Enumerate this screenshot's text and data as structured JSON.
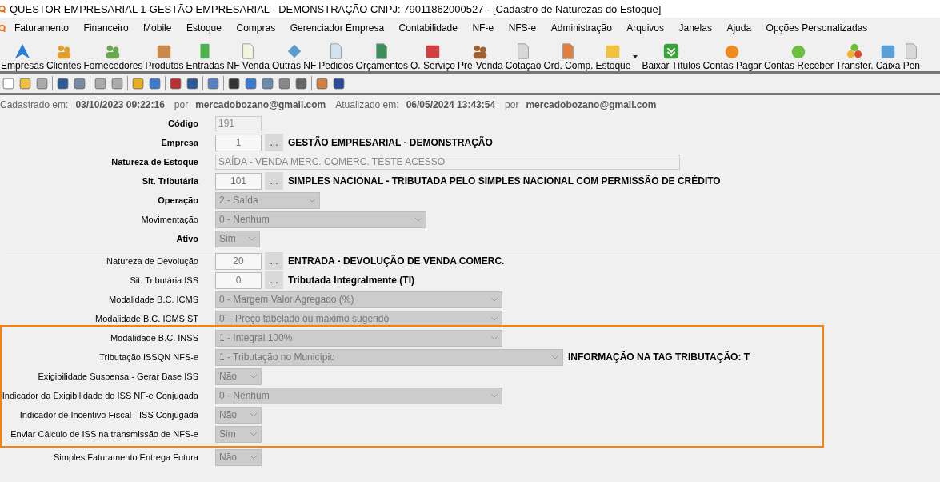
{
  "window": {
    "title": "QUESTOR EMPRESARIAL 1-GESTÃO EMPRESARIAL - DEMONSTRAÇÃO CNPJ: 79011862000527 - [Cadastro de Naturezas do Estoque]"
  },
  "menu": [
    "Faturamento",
    "Financeiro",
    "Mobile",
    "Estoque",
    "Compras",
    "Gerenciador Empresa",
    "Contabilidade",
    "NF-e",
    "NFS-e",
    "Administração",
    "Arquivos",
    "Janelas",
    "Ajuda",
    "Opções Personalizadas"
  ],
  "toolbar": [
    {
      "label": "Empresas",
      "dropdown": false
    },
    {
      "label": "Clientes",
      "dropdown": false
    },
    {
      "label": "Fornecedores",
      "dropdown": false
    },
    {
      "label": "Produtos",
      "dropdown": false
    },
    {
      "label": "Entradas",
      "dropdown": false
    },
    {
      "label": "NF Venda",
      "dropdown": false
    },
    {
      "label": "Outras NF",
      "dropdown": false
    },
    {
      "label": "Pedidos",
      "dropdown": false
    },
    {
      "label": "Orçamentos",
      "dropdown": false
    },
    {
      "label": "O. Serviço",
      "dropdown": false
    },
    {
      "label": "Pré-Venda",
      "dropdown": false
    },
    {
      "label": "Cotação",
      "dropdown": false
    },
    {
      "label": "Ord. Comp.",
      "dropdown": false
    },
    {
      "label": "Estoque",
      "dropdown": true
    },
    {
      "label": "Baixar Títulos",
      "dropdown": false
    },
    {
      "label": "Contas Pagar",
      "dropdown": false
    },
    {
      "label": "Contas Receber",
      "dropdown": false
    },
    {
      "label": "Transfer.",
      "dropdown": false
    },
    {
      "label": "Caixa",
      "dropdown": false
    },
    {
      "label": "Pen",
      "dropdown": false
    }
  ],
  "record_info": {
    "created_label": "Cadastrado em:",
    "created_at": "03/10/2023 09:22:16",
    "created_by_label": "por",
    "created_by": "mercadobozano@gmail.com",
    "updated_label": "Atualizado em:",
    "updated_at": "06/05/2024 13:43:54",
    "updated_by_label": "por",
    "updated_by": "mercadobozano@gmail.com"
  },
  "form": {
    "rows": [
      {
        "label": "Código",
        "bold": true,
        "kind": "text",
        "value": "191"
      },
      {
        "label": "Empresa",
        "bold": true,
        "kind": "lookup",
        "value": "1",
        "button": "...",
        "description": "GESTÃO EMPRESARIAL - DEMONSTRAÇÃO"
      },
      {
        "label": "Natureza de Estoque",
        "bold": true,
        "kind": "text",
        "value": "SAÍDA - VENDA MERC. COMERC. TESTE ACESSO"
      },
      {
        "label": "Sit. Tributária",
        "bold": true,
        "kind": "lookup",
        "value": "101",
        "button": "...",
        "description": "SIMPLES NACIONAL - TRIBUTADA PELO SIMPLES NACIONAL COM PERMISSÃO DE CRÉDITO"
      },
      {
        "label": "Operação",
        "bold": true,
        "kind": "select",
        "value": "2 - Saída"
      },
      {
        "label": "Movimentação",
        "bold": false,
        "kind": "select",
        "value": "0 - Nenhum"
      },
      {
        "label": "Ativo",
        "bold": true,
        "kind": "select",
        "value": "Sim"
      },
      {
        "label": "Natureza de Devolução",
        "bold": false,
        "kind": "lookup",
        "value": "20",
        "button": "...",
        "description": "ENTRADA - DEVOLUÇÃO DE VENDA COMERC."
      },
      {
        "label": "Sit. Tributária ISS",
        "bold": false,
        "kind": "lookup",
        "value": "0",
        "button": "...",
        "description": "Tributada Integralmente (TI)"
      },
      {
        "label": "Modalidade B.C. ICMS",
        "bold": false,
        "kind": "select",
        "value": "0 - Margem Valor Agregado (%)"
      },
      {
        "label": "Modalidade B.C. ICMS ST",
        "bold": false,
        "kind": "select",
        "value": "0 – Preço tabelado ou máximo sugerido"
      },
      {
        "label": "Modalidade B.C. INSS",
        "bold": false,
        "kind": "select",
        "value": "1 - Integral 100%"
      },
      {
        "label": "Tributação ISSQN NFS-e",
        "bold": false,
        "kind": "select",
        "value": "1 - Tributação no Município",
        "note": "INFORMAÇÃO NA TAG TRIBUTAÇÃO: T"
      },
      {
        "label": "Exigibilidade Suspensa - Gerar Base ISS",
        "bold": false,
        "kind": "select",
        "value": "Não"
      },
      {
        "label": "Indicador da Exigibilidade do ISS NF-e Conjugada",
        "bold": false,
        "kind": "select",
        "value": "0 - Nenhum"
      },
      {
        "label": "Indicador de Incentivo Fiscal - ISS Conjugada",
        "bold": false,
        "kind": "select",
        "value": "Não"
      },
      {
        "label": "Enviar Cálculo de ISS na transmissão de NFS-e",
        "bold": false,
        "kind": "select",
        "value": "Sim"
      },
      {
        "label": "Simples Faturamento Entrega Futura",
        "bold": false,
        "kind": "select",
        "value": "Não"
      }
    ]
  }
}
